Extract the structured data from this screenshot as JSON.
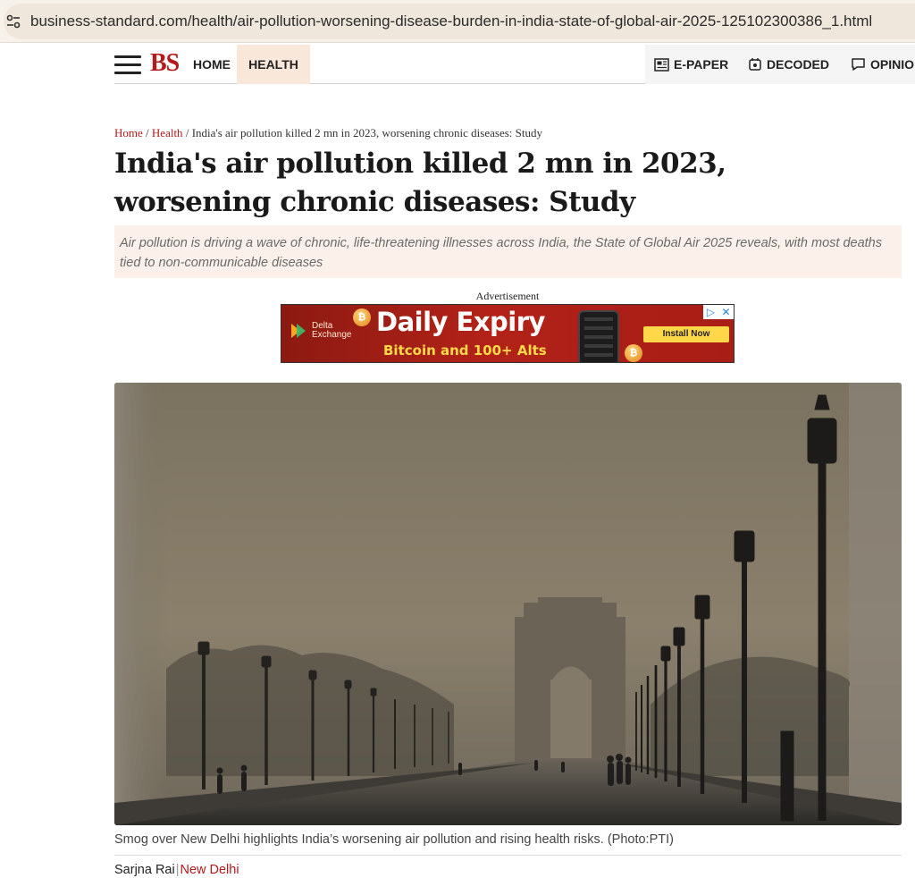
{
  "browser": {
    "url": "business-standard.com/health/air-pollution-worsening-disease-burden-in-india-state-of-global-air-2025-125102300386_1.html",
    "site_info_icon": "tune-icon"
  },
  "header": {
    "menu_icon": "hamburger-icon",
    "logo": "BS",
    "nav_home": "HOME",
    "nav_health": "HEALTH",
    "nav_epaper": "E-PAPER",
    "nav_decoded": "DECODED",
    "nav_opinion": "OPINIO",
    "brand_color": "#b31b1b"
  },
  "breadcrumb": {
    "home": "Home",
    "sep1": "/",
    "section": "Health",
    "sep2": "/",
    "current": "India's air pollution killed 2 mn in 2023, worsening chronic diseases: Study"
  },
  "article": {
    "headline": "India's air pollution killed 2 mn in 2023, worsening chronic diseases: Study",
    "summary": "Air pollution is driving a wave of chronic, life-threatening illnesses across India, the State of Global Air 2025 reveals, with most deaths tied to non-communicable diseases",
    "photo_caption": "Smog over New Delhi highlights India’s worsening air pollution and rising health risks. (Photo:PTI)",
    "author": "Sarjna Rai",
    "byline_sep": "|",
    "location": "New Delhi"
  },
  "ad": {
    "label": "Advertisement",
    "brand_line1": "Delta",
    "brand_line2": "Exchange",
    "title": "Daily Expiry",
    "subtitle": "Bitcoin and 100+ Alts",
    "cta": "Install Now",
    "coin_glyph": "₿",
    "adchoices_play": "▷",
    "adchoices_close": "✕"
  }
}
